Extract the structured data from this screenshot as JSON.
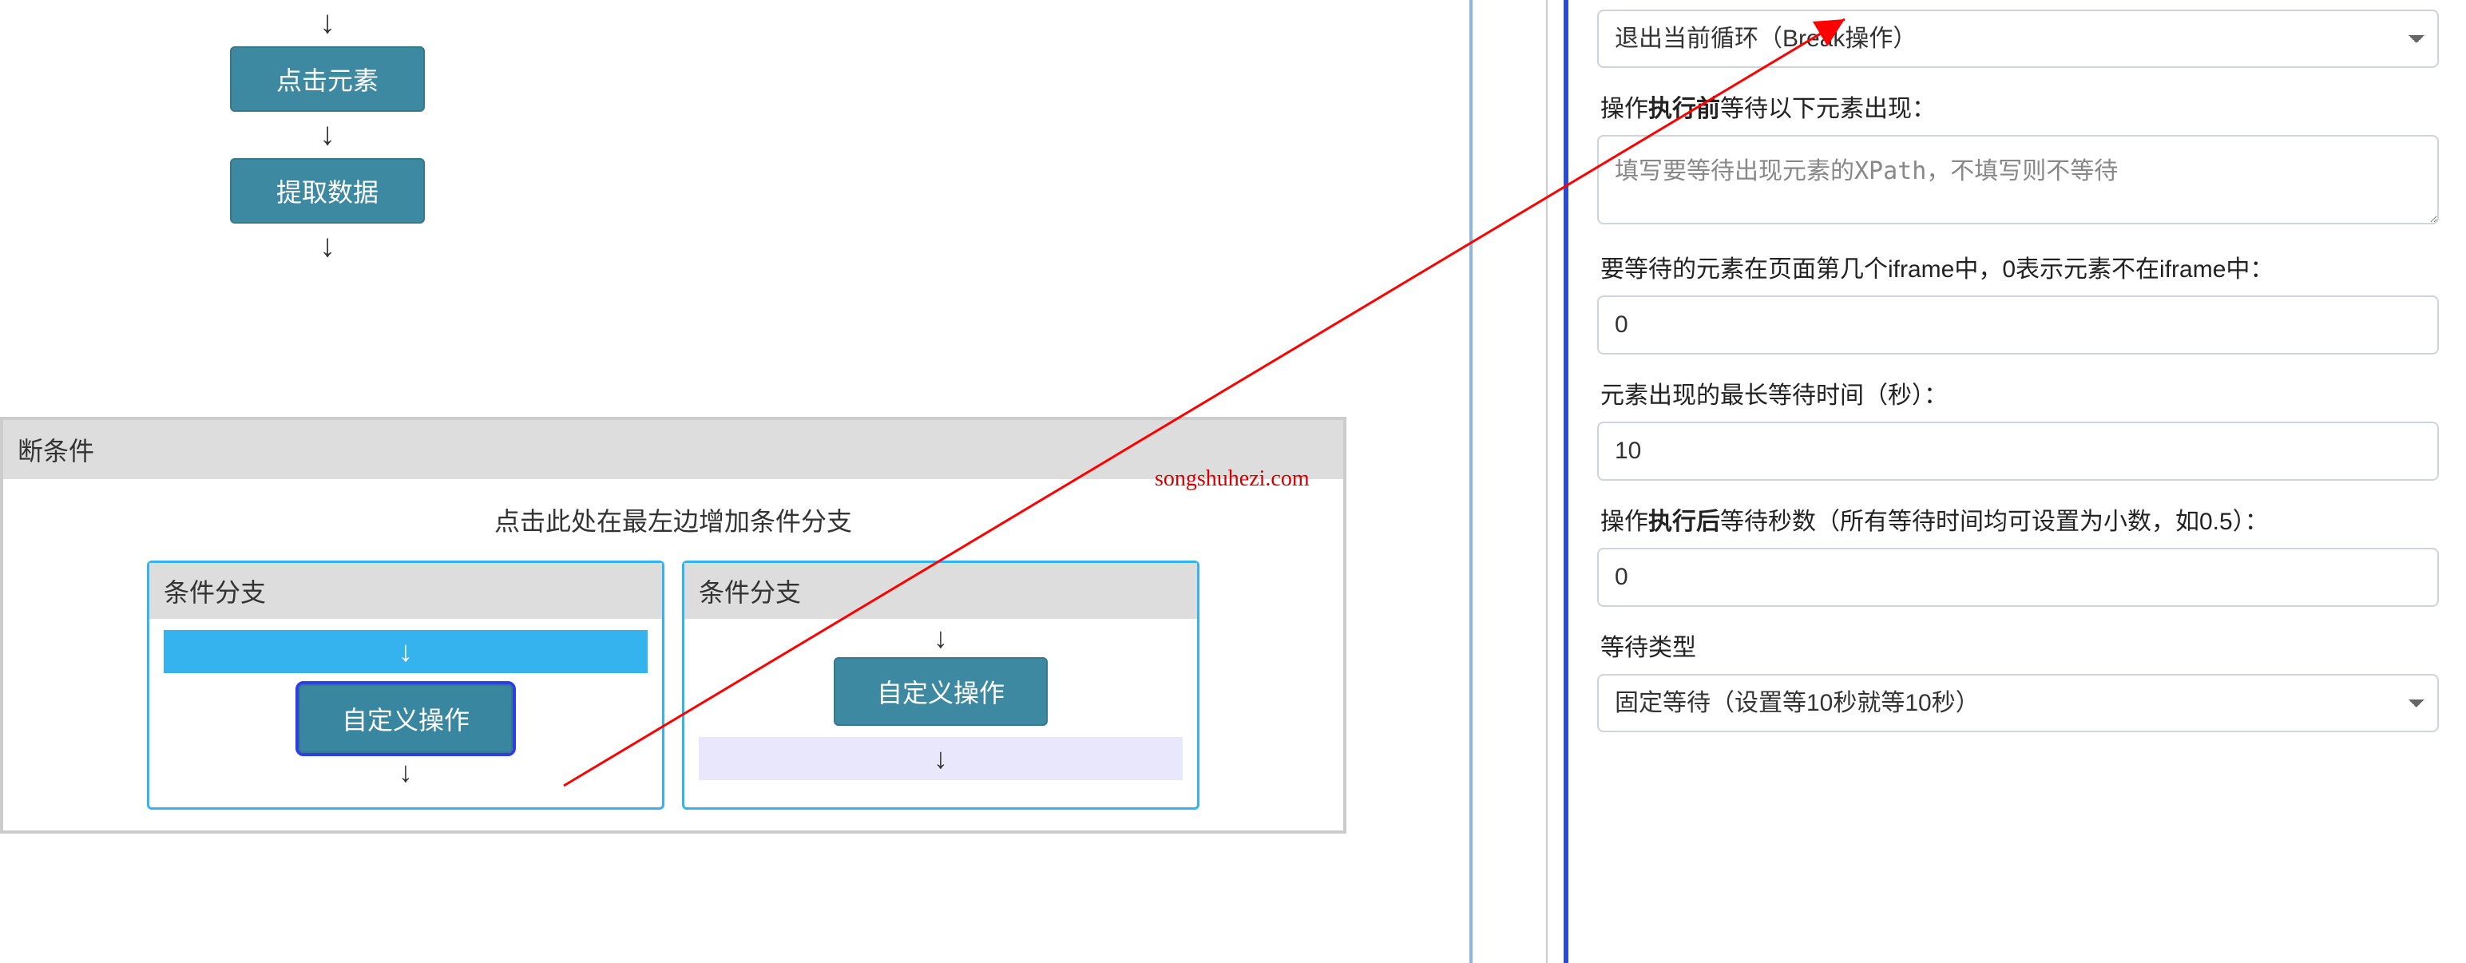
{
  "flow": {
    "node_click": "点击元素",
    "node_extract": "提取数据",
    "arrow": "↓"
  },
  "condition": {
    "title": "断条件",
    "hint": "点击此处在最左边增加条件分支",
    "branch_label": "条件分支",
    "custom_op": "自定义操作"
  },
  "form": {
    "operation_type_value": "退出当前循环（Break操作）",
    "before_wait_label_pre": "操作",
    "before_wait_label_bold": "执行前",
    "before_wait_label_post": "等待以下元素出现：",
    "before_wait_placeholder": "填写要等待出现元素的XPath，不填写则不等待",
    "iframe_label": "要等待的元素在页面第几个iframe中，0表示元素不在iframe中：",
    "iframe_value": "0",
    "max_wait_label": "元素出现的最长等待时间（秒）：",
    "max_wait_value": "10",
    "after_wait_label_pre": "操作",
    "after_wait_label_bold": "执行后",
    "after_wait_label_post": "等待秒数（所有等待时间均可设置为小数，如0.5）：",
    "after_wait_value": "0",
    "wait_type_label": "等待类型",
    "wait_type_value": "固定等待（设置等10秒就等10秒）"
  },
  "watermark": "songshuhezi.com"
}
